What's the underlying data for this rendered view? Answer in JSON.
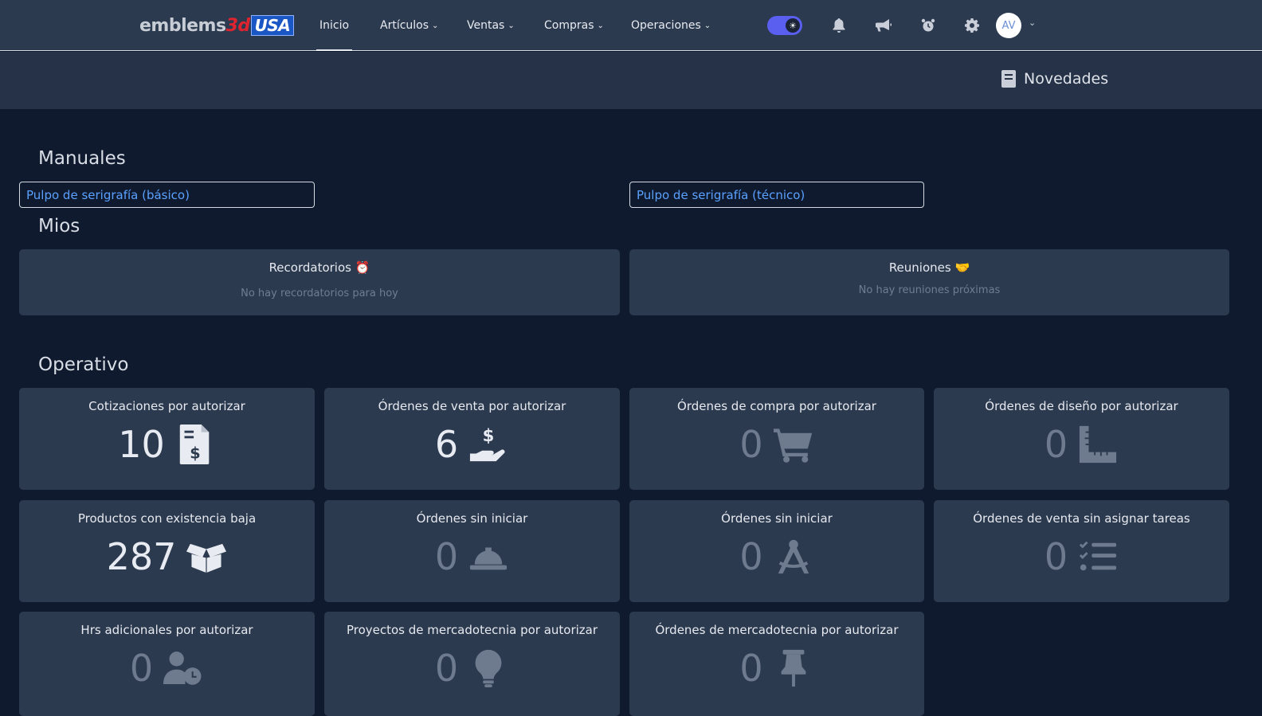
{
  "navbar": {
    "logo": {
      "part1": "emblems",
      "part2": "3d",
      "part3": "USA"
    },
    "items": [
      {
        "label": "Inicio",
        "active": true
      },
      {
        "label": "Artículos",
        "dropdown": true
      },
      {
        "label": "Ventas",
        "dropdown": true
      },
      {
        "label": "Compras",
        "dropdown": true
      },
      {
        "label": "Operaciones",
        "dropdown": true
      }
    ],
    "avatar_initials": "AV",
    "icons": [
      "theme-toggle-icon",
      "bell-icon",
      "megaphone-icon",
      "alarm-clock-icon",
      "gear-icon"
    ]
  },
  "subheader": {
    "novedades_label": "Novedades"
  },
  "manuales": {
    "title": "Manuales",
    "links": [
      "Pulpo de serigrafía (básico)",
      "Pulpo de serigrafía (técnico)"
    ]
  },
  "mios": {
    "title": "Mios",
    "recordatorios": {
      "title": "Recordatorios",
      "empty": "No hay recordatorios para hoy"
    },
    "reuniones": {
      "title": "Reuniones",
      "empty": "No hay reuniones próximas"
    }
  },
  "operativo": {
    "title": "Operativo",
    "cards": [
      {
        "title": "Cotizaciones por autorizar",
        "count": "10",
        "icon": "invoice-dollar-icon"
      },
      {
        "title": "Órdenes de venta por autorizar",
        "count": "6",
        "icon": "hand-dollar-icon"
      },
      {
        "title": "Órdenes de compra por autorizar",
        "count": "0",
        "icon": "cart-icon"
      },
      {
        "title": "Órdenes de diseño por autorizar",
        "count": "0",
        "icon": "ruler-combined-icon"
      },
      {
        "title": "Productos con existencia baja",
        "count": "287",
        "icon": "open-box-icon"
      },
      {
        "title": "Órdenes sin iniciar",
        "count": "0",
        "icon": "hard-hat-icon"
      },
      {
        "title": "Órdenes sin iniciar",
        "count": "0",
        "icon": "compass-drafting-icon"
      },
      {
        "title": "Órdenes de venta sin asignar tareas",
        "count": "0",
        "icon": "list-check-icon"
      },
      {
        "title": "Hrs adicionales por autorizar",
        "count": "0",
        "icon": "user-clock-icon"
      },
      {
        "title": "Proyectos de mercadotecnia por autorizar",
        "count": "0",
        "icon": "lightbulb-icon"
      },
      {
        "title": "Órdenes de mercadotecnia por autorizar",
        "count": "0",
        "icon": "thumbtack-icon"
      }
    ]
  },
  "colors": {
    "background": "#0f1a2e",
    "panel": "#2c3a4f",
    "navbar": "#2c3a4f",
    "link": "#5aa1ff",
    "toggle": "#5b5ff0"
  }
}
